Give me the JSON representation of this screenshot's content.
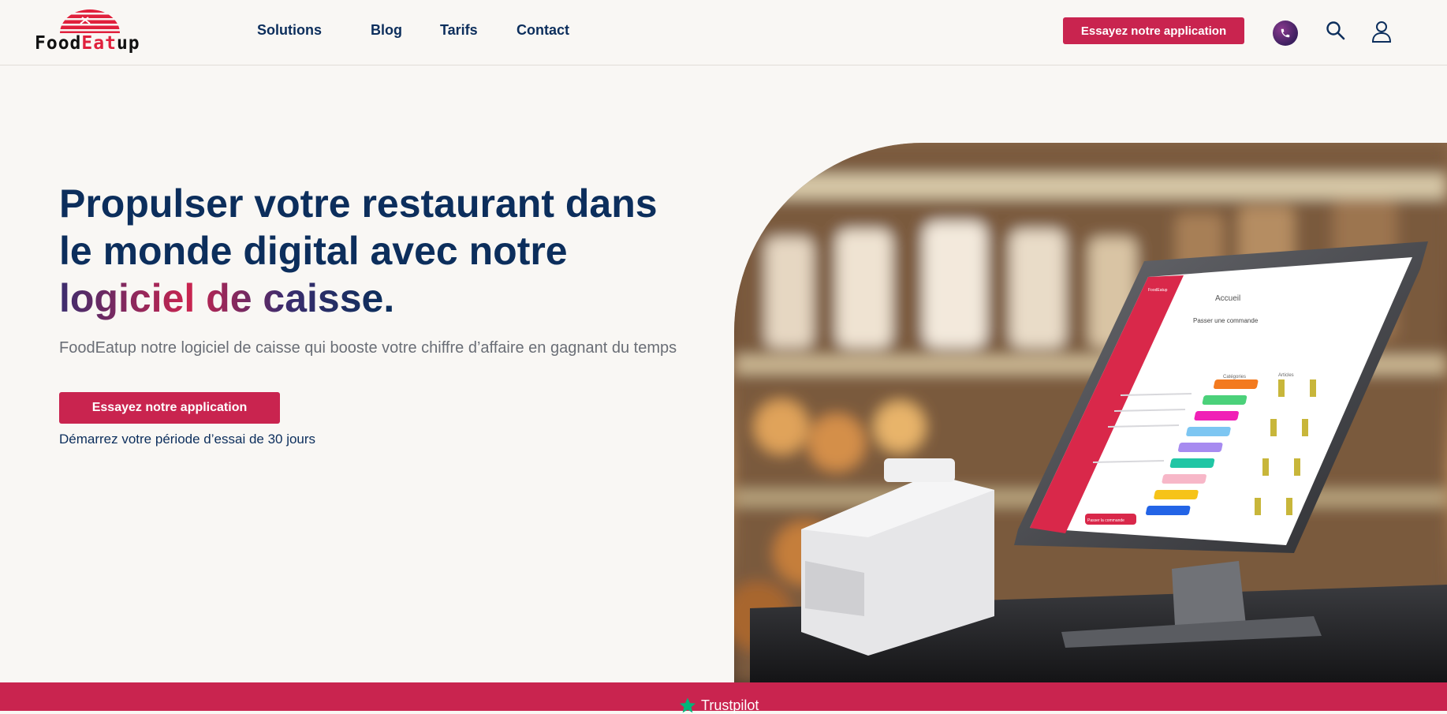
{
  "brand": {
    "name_part1": "Food",
    "name_part2": "Eat",
    "name_part3": "up",
    "accent_color": "#c9244f",
    "navy_color": "#0c2e5c"
  },
  "nav": {
    "items": [
      {
        "label": "Solutions"
      },
      {
        "label": "Blog"
      },
      {
        "label": "Tarifs"
      },
      {
        "label": "Contact"
      }
    ],
    "cta_label": "Essayez notre application",
    "icons": [
      "phone-icon",
      "search-icon",
      "user-icon"
    ]
  },
  "hero": {
    "title_line1": "Propulser votre restaurant dans",
    "title_line2": "le monde digital avec notre",
    "title_highlight": "logiciel de caisse",
    "title_end": ".",
    "subtitle": "FoodEatup notre logiciel de caisse qui booste votre chiffre d’affaire en gagnant du temps",
    "cta_label": "Essayez notre application",
    "trial_text": "Démarrez votre période d’essai de 30 jours"
  },
  "screen": {
    "brand": "FoodEatup",
    "title": "Accueil",
    "heading": "Passer une commande",
    "col_categories": "Catégories",
    "col_articles": "Articles",
    "button": "Passer la commande"
  },
  "footer_band": {
    "trustpilot_label": "Trustpilot"
  }
}
